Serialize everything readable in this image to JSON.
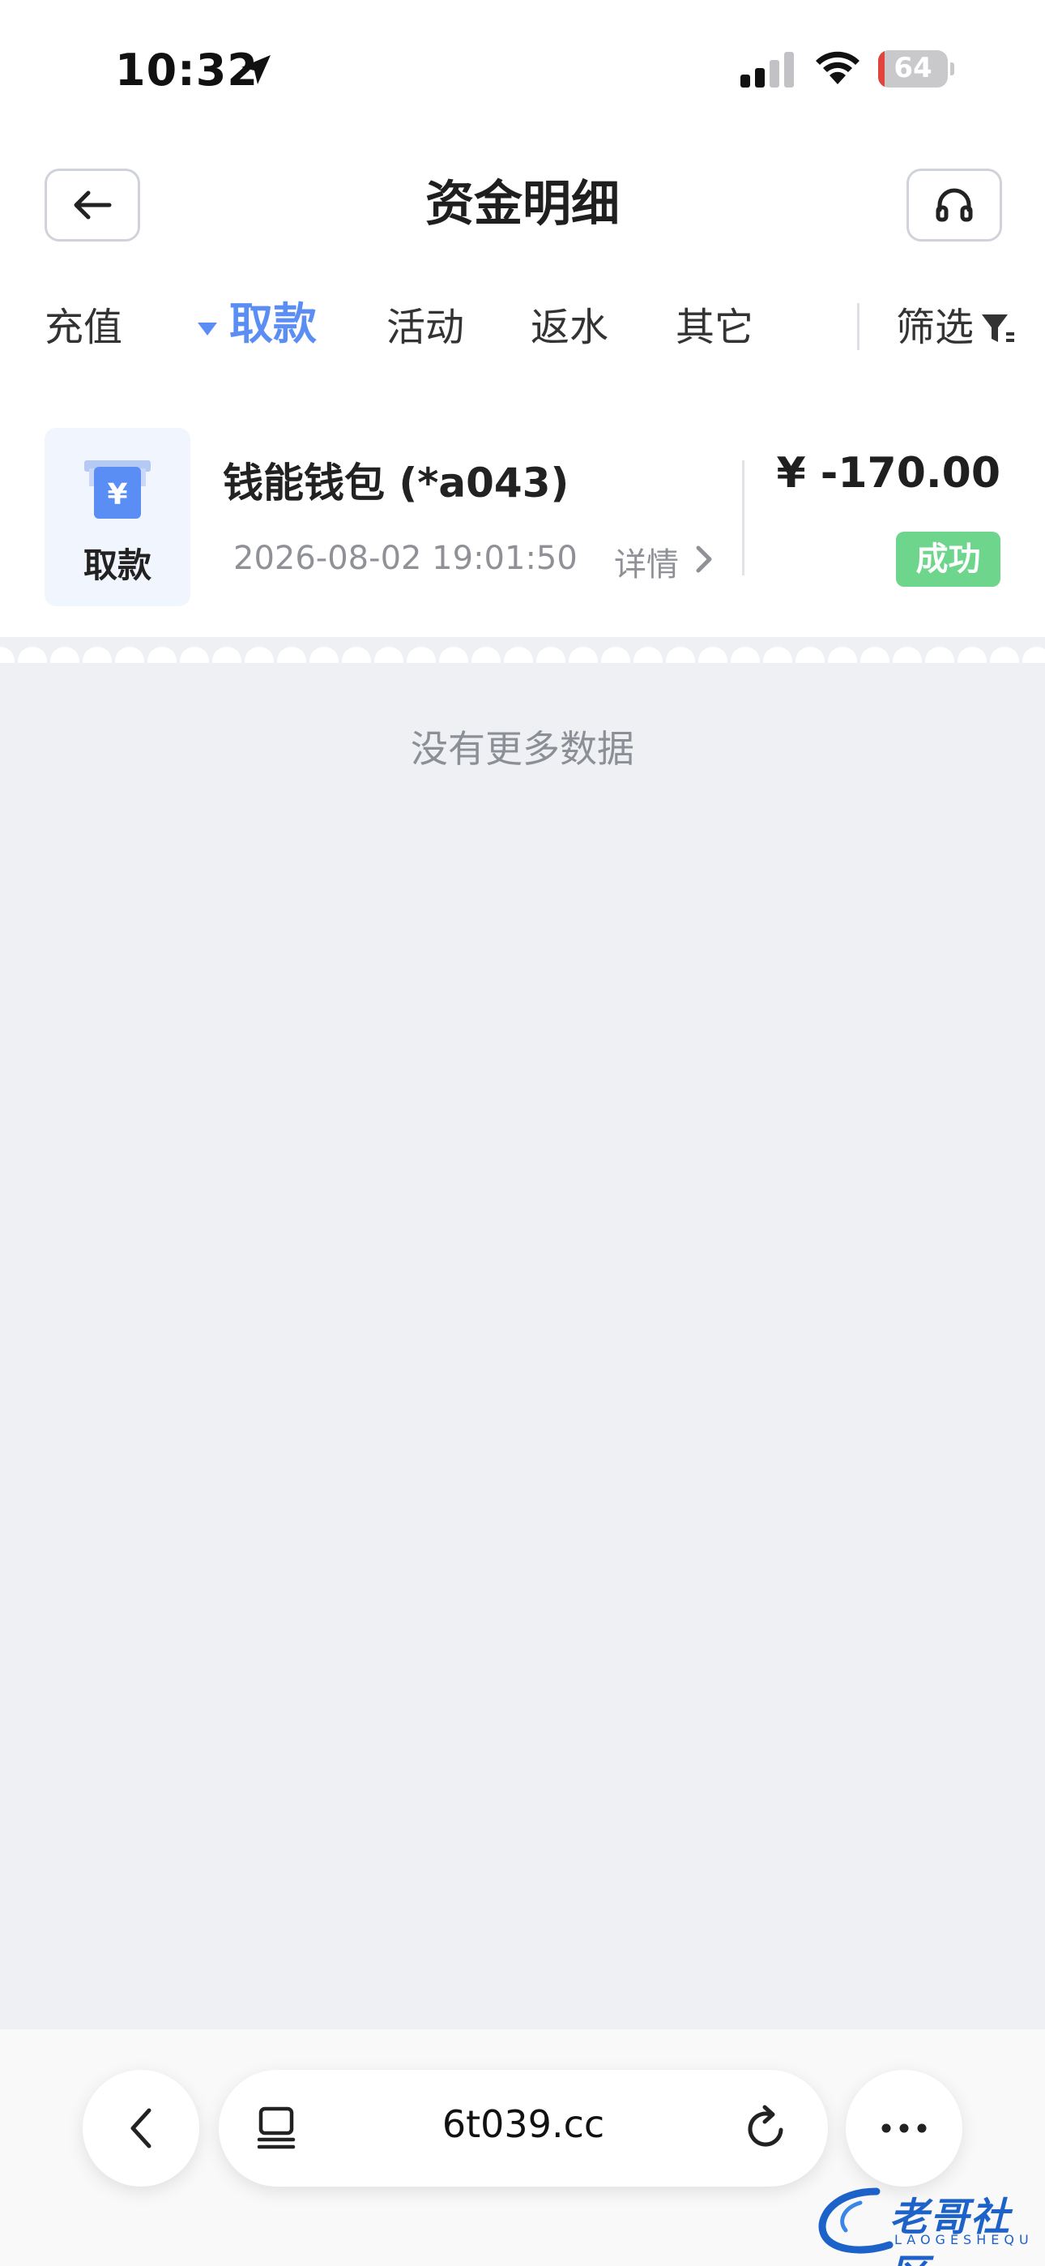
{
  "status_bar": {
    "time": "10:32",
    "battery": "64"
  },
  "header": {
    "title": "资金明细"
  },
  "tabs": [
    {
      "label": "充值",
      "active": false
    },
    {
      "label": "取款",
      "active": true
    },
    {
      "label": "活动",
      "active": false
    },
    {
      "label": "返水",
      "active": false
    },
    {
      "label": "其它",
      "active": false
    }
  ],
  "filter_label": "筛选",
  "records": [
    {
      "type_label": "取款",
      "title": "钱能钱包 (*a043)",
      "datetime": "2026-08-02 19:01:50",
      "detail_label": "详情",
      "amount": "¥  -170.00",
      "status": "成功"
    }
  ],
  "empty_text": "没有更多数据",
  "browser": {
    "url": "6t039.cc"
  },
  "watermark": {
    "text": "老哥社区",
    "sub": "LAOGESHEQU"
  },
  "colors": {
    "accent": "#5b8ef5",
    "success": "#6dd58c",
    "background": "#eef0f4"
  }
}
